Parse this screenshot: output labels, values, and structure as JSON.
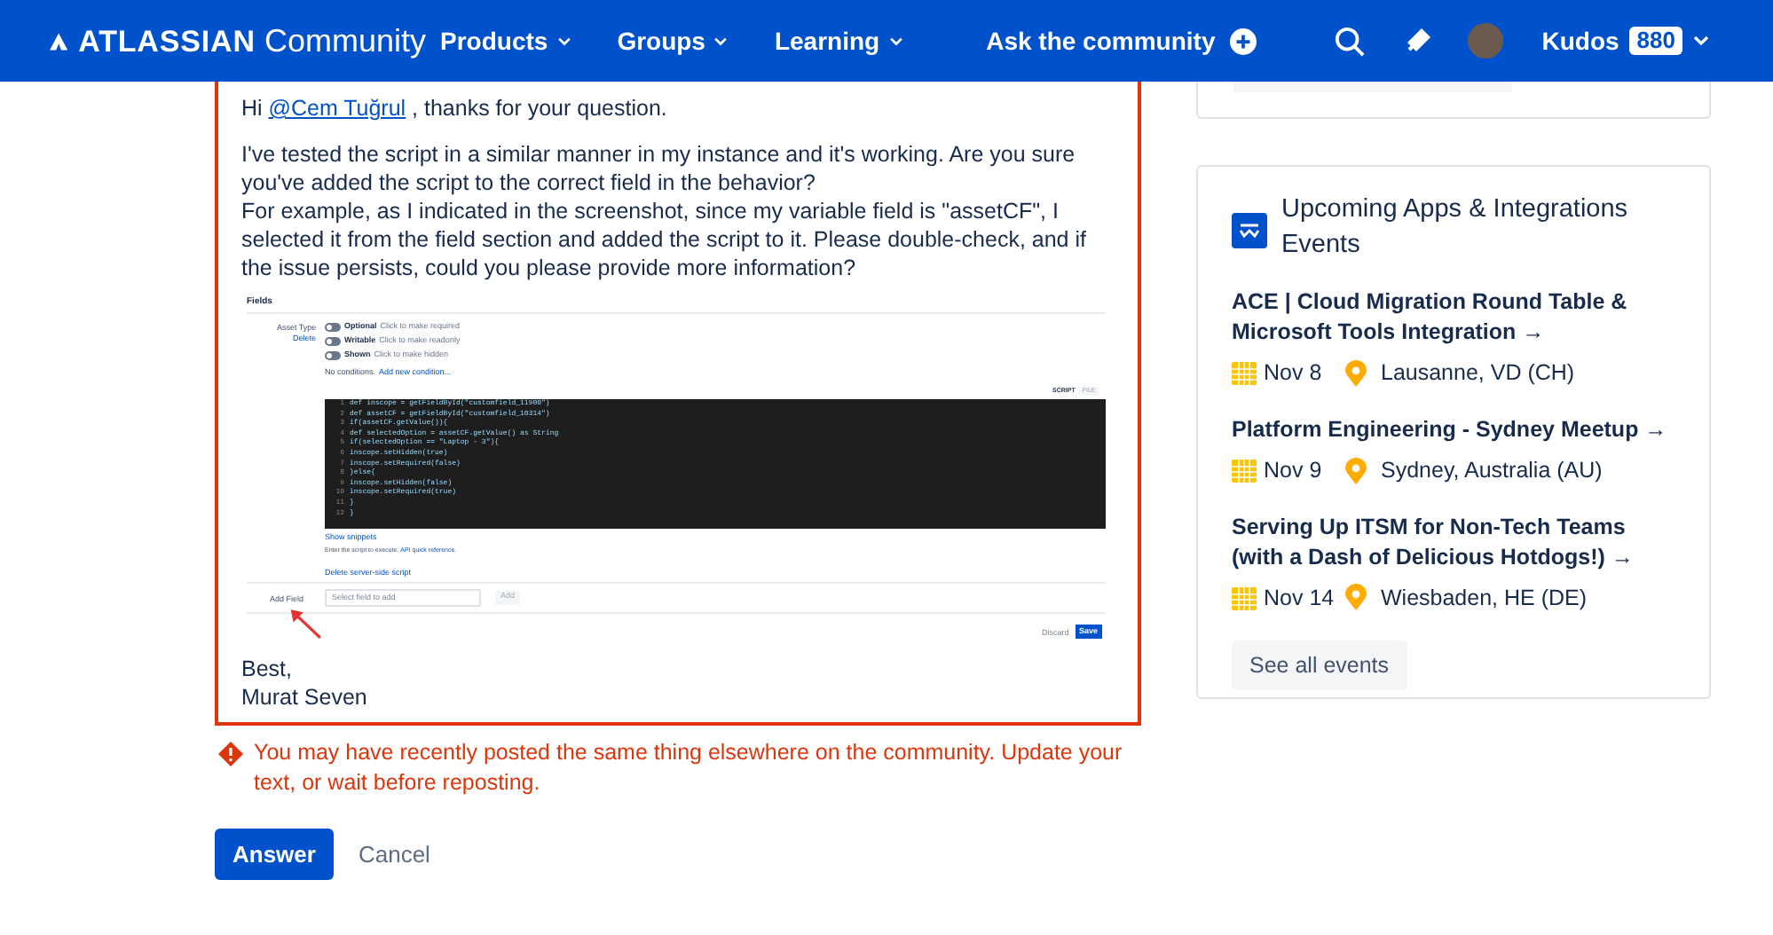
{
  "nav": {
    "logo_brand": "ATLASSIAN",
    "logo_product": "Community",
    "menus": [
      {
        "label": "Products"
      },
      {
        "label": "Groups"
      },
      {
        "label": "Learning"
      }
    ],
    "ask_label": "Ask the community",
    "kudos_label": "Kudos",
    "kudos_count": "880"
  },
  "reply": {
    "greeting_before": "Hi ",
    "mention": "@Cem Tuğrul",
    "greeting_after": " , thanks for your question.",
    "paragraphs": [
      "I've tested the script in a similar manner in my instance and it's working. Are you sure you've added the script to the correct field in the behavior?",
      "For example, as I indicated in the screenshot, since my variable field is \"assetCF\", I selected it from the field section and added the script to it. Please double-check, and if the issue persists, could you please provide more information?"
    ],
    "screenshot": {
      "section_title": "Fields",
      "field_label": "Asset Type",
      "delete_link": "Delete",
      "toggles": [
        {
          "label": "Optional",
          "hint": "Click to make required",
          "on": false
        },
        {
          "label": "Writable",
          "hint": "Click to make readonly",
          "on": false
        },
        {
          "label": "Shown",
          "hint": "Click to make hidden",
          "on": false
        }
      ],
      "conditions_text": "No conditions.",
      "add_condition": "Add new condition...",
      "tabs": [
        {
          "label": "SCRIPT",
          "selected": true
        },
        {
          "label": "FILE",
          "selected": false
        }
      ],
      "code_lines": [
        {
          "number": "1",
          "text": "def inscope = getFieldById(\"customfield_11900\")"
        },
        {
          "number": "2",
          "text": "def assetCF = getFieldById(\"customfield_10314\")"
        },
        {
          "number": "3",
          "text": "if(assetCF.getValue()){"
        },
        {
          "number": "4",
          "text": "def selectedOption = assetCF.getValue() as String"
        },
        {
          "number": "5",
          "text": "if(selectedOption == \"Laptop - 3\"){"
        },
        {
          "number": "6",
          "text": "inscope.setHidden(true)"
        },
        {
          "number": "7",
          "text": "inscope.setRequired(false)"
        },
        {
          "number": "8",
          "text": "}else{"
        },
        {
          "number": "9",
          "text": "inscope.setHidden(false)"
        },
        {
          "number": "10",
          "text": "inscope.setRequired(true)"
        },
        {
          "number": "11",
          "text": "}"
        },
        {
          "number": "12",
          "text": "}"
        }
      ],
      "show_snippets": "Show snippets",
      "help_text": "Enter the script to execute.",
      "api_link": "API quick reference.",
      "delete_script": "Delete server-side script",
      "add_field_label": "Add Field",
      "select_placeholder": "Select field to add",
      "add_button": "Add",
      "discard": "Discard",
      "save": "Save"
    },
    "signoff": [
      "Best,",
      "Murat Seven"
    ]
  },
  "error": "You may have recently posted the same thing elsewhere on the community. Update your text, or wait before reposting.",
  "buttons": {
    "answer": "Answer",
    "cancel": "Cancel"
  },
  "events_card": {
    "title": "Upcoming Apps & Integrations Events",
    "events": [
      {
        "title": "ACE | Cloud Migration Round Table & Microsoft Tools Integration →",
        "date": "Nov 8",
        "location": "Lausanne, VD (CH)"
      },
      {
        "title": "Platform Engineering - Sydney Meetup →",
        "date": "Nov 9",
        "location": "Sydney, Australia (AU)"
      },
      {
        "title": "Serving Up ITSM for Non-Tech Teams (with a Dash of Delicious Hotdogs!) →",
        "date": "Nov 14",
        "location": "Wiesbaden, HE (DE)"
      }
    ],
    "see_all": "See all events"
  }
}
